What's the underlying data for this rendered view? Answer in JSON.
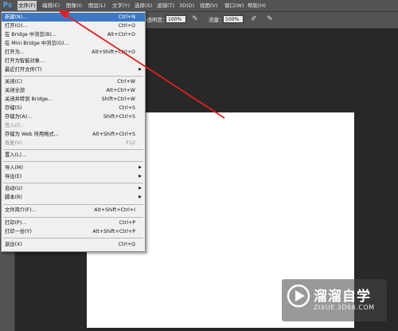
{
  "app": {
    "logo": "Ps"
  },
  "menubar": {
    "items": [
      "文件(F)",
      "编辑(E)",
      "图像(I)",
      "图层(L)",
      "文字(Y)",
      "选择(S)",
      "滤镜(T)",
      "3D(D)",
      "视图(V)",
      "窗口(W)",
      "帮助(H)"
    ],
    "active_index": 0
  },
  "options": {
    "opacity_label": "不透明度：",
    "opacity_value": "100%",
    "flow_label": "流量：",
    "flow_value": "100%"
  },
  "file_menu": {
    "items": [
      {
        "label": "新建(N)...",
        "shortcut": "Ctrl+N",
        "highlighted": true
      },
      {
        "label": "打开(O)...",
        "shortcut": "Ctrl+O"
      },
      {
        "label": "在 Bridge 中浏览(B)...",
        "shortcut": "Alt+Ctrl+O"
      },
      {
        "label": "在 Mini Bridge 中浏览(G)...",
        "shortcut": ""
      },
      {
        "label": "打开为...",
        "shortcut": "Alt+Shift+Ctrl+O"
      },
      {
        "label": "打开为智能对象...",
        "shortcut": ""
      },
      {
        "label": "最近打开文件(T)",
        "shortcut": "",
        "submenu": true
      },
      {
        "label": "关闭(C)",
        "shortcut": "Ctrl+W"
      },
      {
        "label": "关闭全部",
        "shortcut": "Alt+Ctrl+W"
      },
      {
        "label": "关闭并转到 Bridge...",
        "shortcut": "Shift+Ctrl+W"
      },
      {
        "label": "存储(S)",
        "shortcut": "Ctrl+S"
      },
      {
        "label": "存储为(A)...",
        "shortcut": "Shift+Ctrl+S"
      },
      {
        "label": "签入(I)...",
        "shortcut": "",
        "disabled": true
      },
      {
        "label": "存储为 Web 所用格式...",
        "shortcut": "Alt+Shift+Ctrl+S"
      },
      {
        "label": "恢复(V)",
        "shortcut": "F12",
        "disabled": true
      },
      {
        "label": "置入(L)...",
        "shortcut": ""
      },
      {
        "label": "导入(M)",
        "shortcut": "",
        "submenu": true
      },
      {
        "label": "导出(E)",
        "shortcut": "",
        "submenu": true
      },
      {
        "label": "自动(U)",
        "shortcut": "",
        "submenu": true
      },
      {
        "label": "脚本(R)",
        "shortcut": "",
        "submenu": true
      },
      {
        "label": "文件简介(F)...",
        "shortcut": "Alt+Shift+Ctrl+I"
      },
      {
        "label": "打印(P)...",
        "shortcut": "Ctrl+P"
      },
      {
        "label": "打印一份(Y)",
        "shortcut": "Alt+Shift+Ctrl+P"
      },
      {
        "label": "退出(X)",
        "shortcut": "Ctrl+Q"
      }
    ]
  },
  "watermark": {
    "title": "溜溜自学",
    "subtitle": "ZIXUE.3D66.COM"
  },
  "colors": {
    "ui_bg": "#535353",
    "workspace": "#282828",
    "highlight": "#3c78c3",
    "arrow": "#e02020"
  }
}
